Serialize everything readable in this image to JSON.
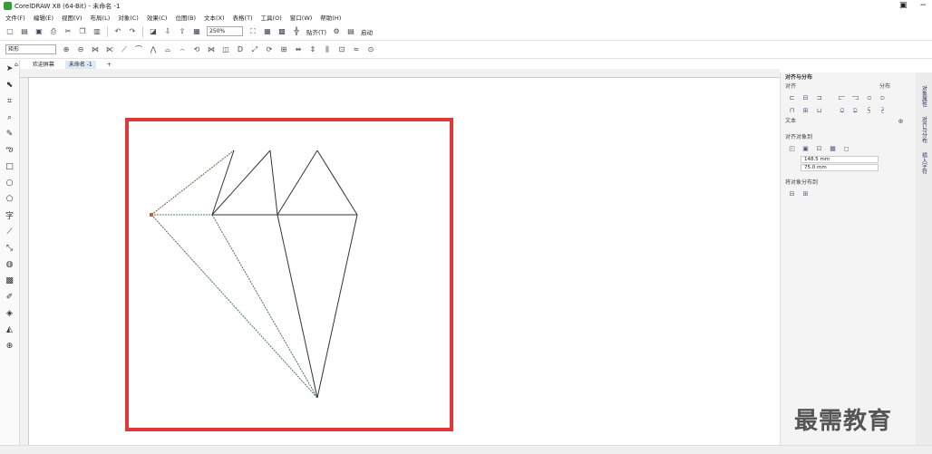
{
  "window": {
    "title": "CorelDRAW X8 (64-Bit) - 未命名 -1"
  },
  "menu": [
    "文件(F)",
    "编辑(E)",
    "视图(V)",
    "布局(L)",
    "对象(C)",
    "效果(C)",
    "位图(B)",
    "文本(X)",
    "表格(T)",
    "工具(O)",
    "窗口(W)",
    "帮助(H)"
  ],
  "toolbar": {
    "zoom": "250%",
    "snap_label": "贴齐(T)",
    "launch_label": "启动"
  },
  "property_bar": {
    "shape_select": "矩形"
  },
  "tabs": [
    "欢迎屏幕",
    "未命名 -1"
  ],
  "docker": {
    "title": "对齐与分布",
    "align_label": "对齐",
    "distribute_label": "分布",
    "text_label": "文本",
    "align_to_label": "对齐对象到",
    "x_value": "148.5 mm",
    "y_value": "75.0 mm",
    "distribute_to_label": "将对象分布到"
  },
  "side_tabs": [
    "对象属性",
    "对齐与分布",
    "插入字符"
  ],
  "watermark": "最需教育",
  "colors": {
    "page_frame": "#e03838"
  }
}
